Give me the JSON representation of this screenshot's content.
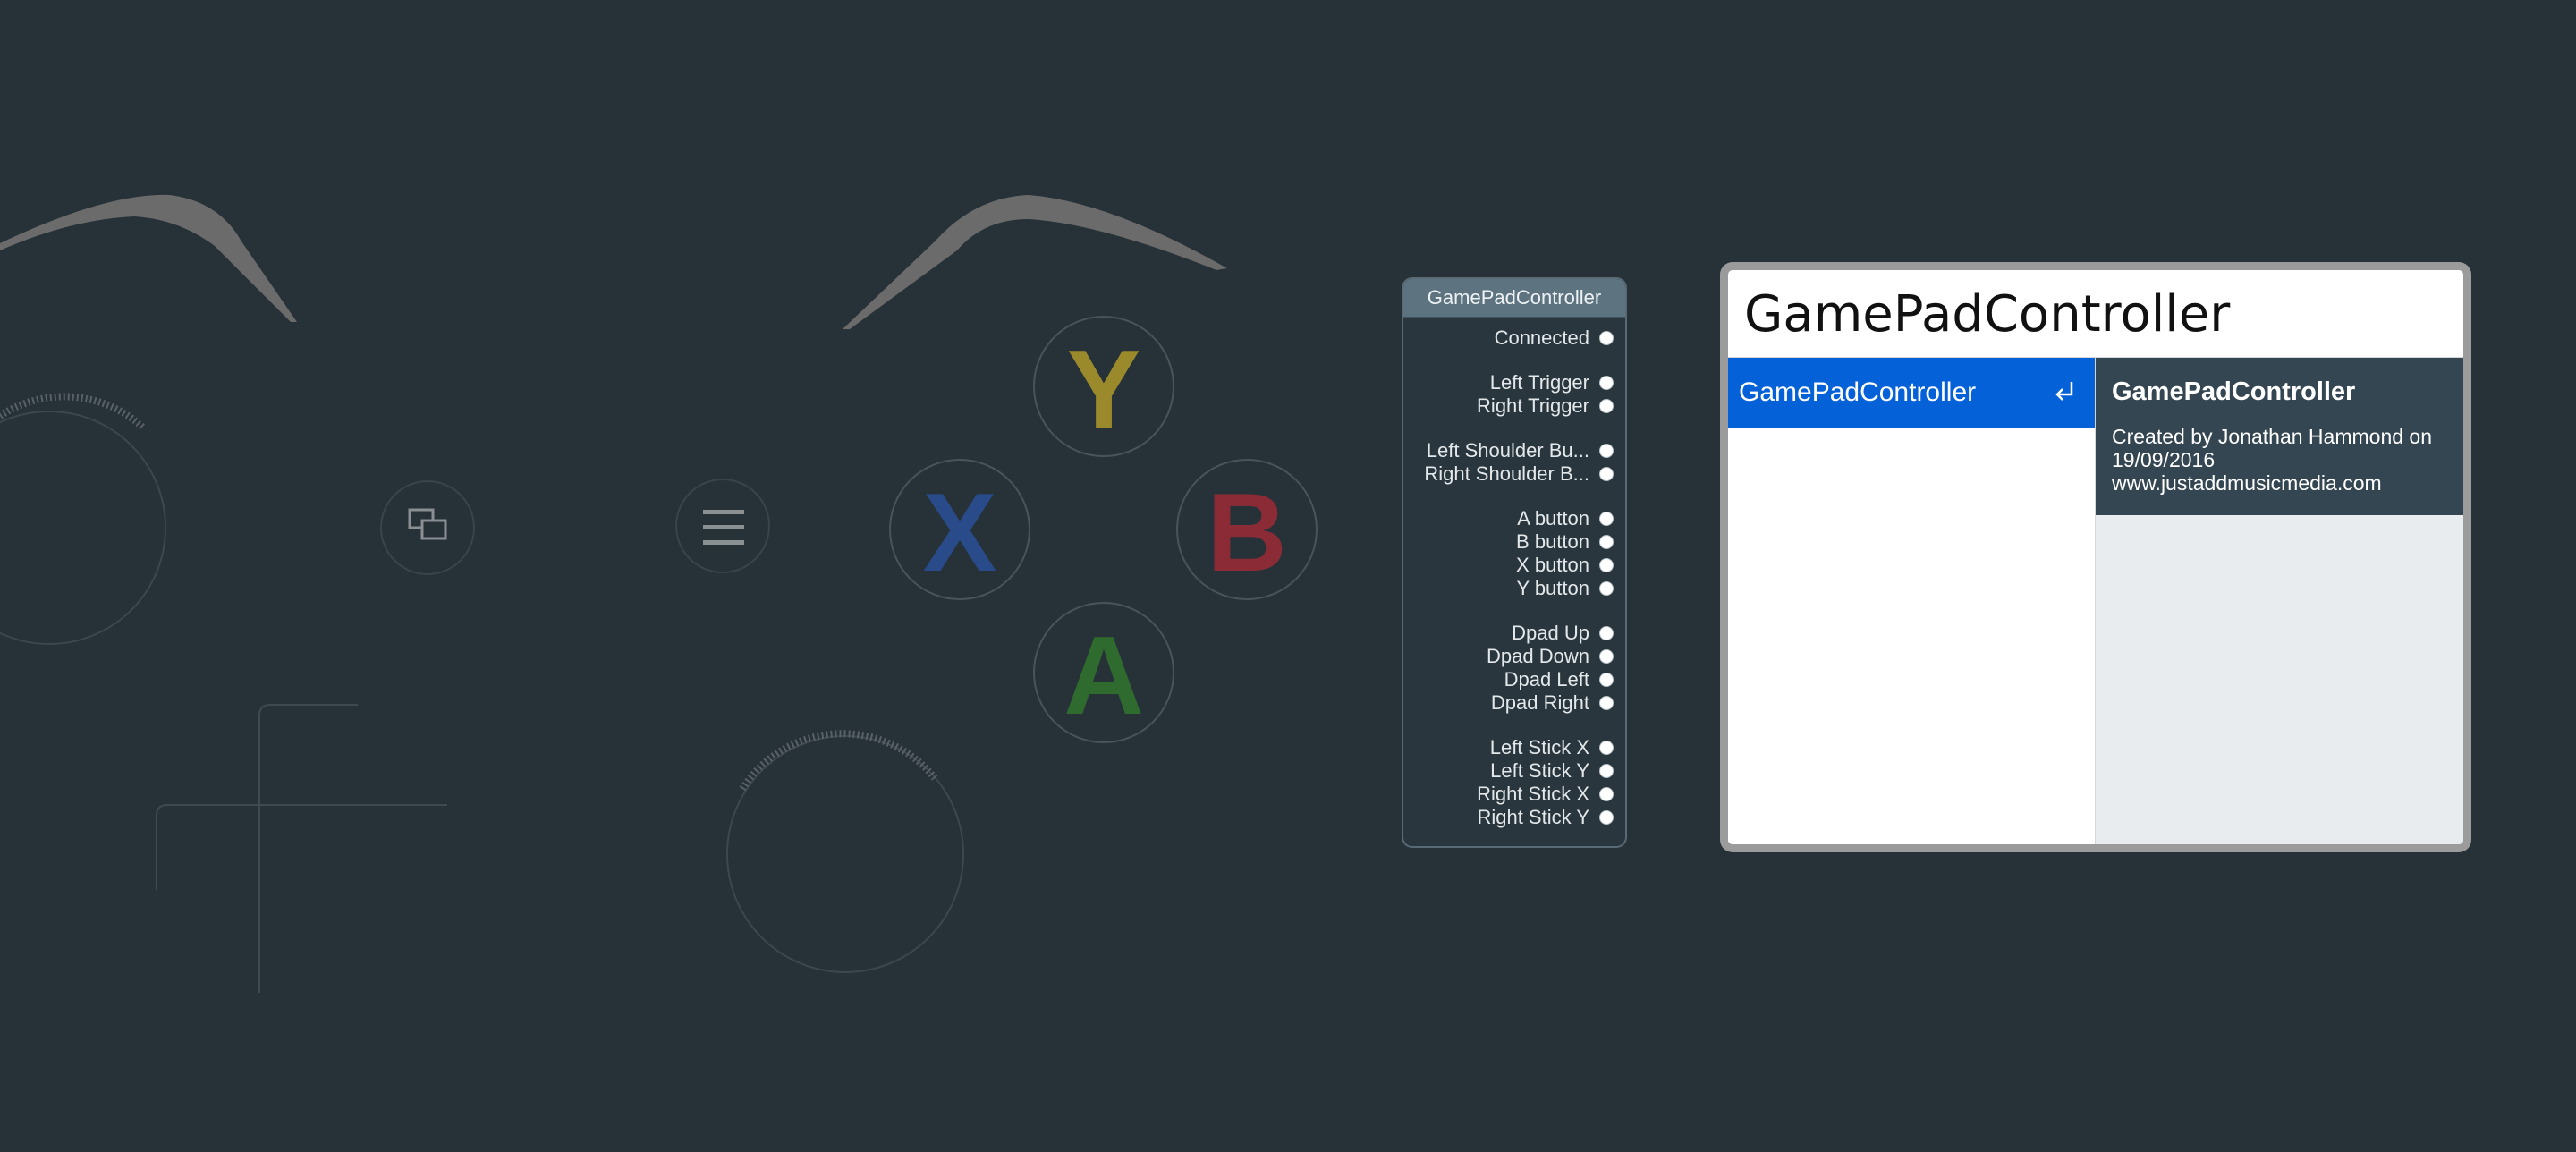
{
  "controller": {
    "face_buttons": [
      {
        "name": "Y",
        "color": "#9a8a2c"
      },
      {
        "name": "X",
        "color": "#2a4b8a"
      },
      {
        "name": "B",
        "color": "#8a2b36"
      },
      {
        "name": "A",
        "color": "#2f6a2e"
      }
    ],
    "icons": [
      "view-icon",
      "menu-icon"
    ]
  },
  "node": {
    "title": "GamePadController",
    "groups": [
      [
        "Connected"
      ],
      [
        "Left Trigger",
        "Right Trigger"
      ],
      [
        "Left Shoulder Bu...",
        "Right Shoulder B..."
      ],
      [
        "A button",
        "B button",
        "X button",
        "Y button"
      ],
      [
        "Dpad Up",
        "Dpad Down",
        "Dpad Left",
        "Dpad Right"
      ],
      [
        "Left Stick X",
        "Left Stick Y",
        "Right Stick X",
        "Right Stick Y"
      ]
    ]
  },
  "search": {
    "query": "GamePadController",
    "results": [
      {
        "label": "GamePadController",
        "selected": true,
        "icon": "return-key-icon"
      }
    ],
    "details": {
      "title": "GamePadController",
      "description": "Created by Jonathan Hammond on\n19/09/2016\nwww.justaddmusicmedia.com"
    }
  },
  "colors": {
    "background": "#263138",
    "selection": "#0561d8",
    "details_header": "#344651",
    "node_header": "#5d7480"
  }
}
